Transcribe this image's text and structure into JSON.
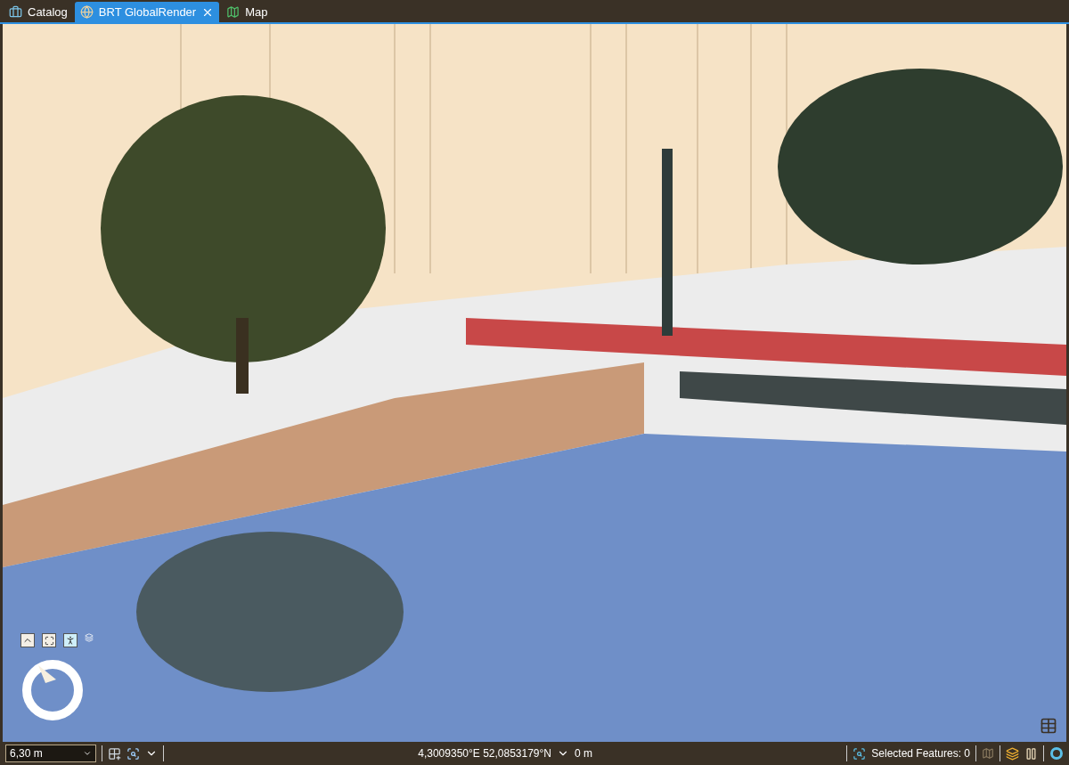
{
  "tabs": [
    {
      "label": "Catalog",
      "kind": "catalog",
      "selected": false
    },
    {
      "label": "BRT GlobalRender",
      "kind": "scene",
      "selected": true
    },
    {
      "label": "Map",
      "kind": "map",
      "selected": false
    }
  ],
  "navigator": {
    "buttons": [
      {
        "kind": "up",
        "selected": false
      },
      {
        "kind": "extent",
        "selected": false
      },
      {
        "kind": "walk",
        "selected": true
      }
    ]
  },
  "status_bar": {
    "scale": "6,30 m",
    "coordinates": "4,3009350°E 52,0853179°N",
    "elevation": "0 m",
    "selected_features": "Selected Features: 0"
  }
}
